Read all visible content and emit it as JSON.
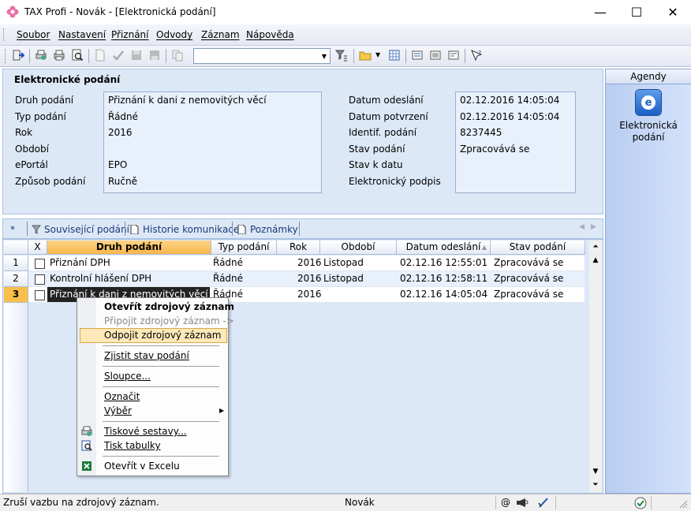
{
  "window": {
    "title": "TAX Profi - Novák - [Elektronická podání]",
    "minimize": "—",
    "maximize": "☐",
    "close": "✕"
  },
  "menu": [
    "Soubor",
    "Nastavení",
    "Přiznání",
    "Odvody",
    "Záznam",
    "Nápověda"
  ],
  "toolbar": {
    "combo_value": ""
  },
  "detail": {
    "title": "Elektronické podání",
    "left_labels": [
      "Druh podání",
      "Typ podání",
      "Rok",
      "Období",
      "ePortál",
      "Způsob podání"
    ],
    "left_values": [
      "Přiznání k dani z nemovitých věcí",
      "Řádné",
      "2016",
      "",
      "EPO",
      "Ručně"
    ],
    "right_labels": [
      "Datum odeslání",
      "Datum potvrzení",
      "Identif. podání",
      "Stav podání",
      "Stav k datu",
      "Elektronický podpis"
    ],
    "right_values": [
      "02.12.2016 14:05:04",
      "02.12.2016 14:05:04",
      "8237445",
      "Zpracovává se",
      "",
      ""
    ]
  },
  "agendy": {
    "title": "Agendy",
    "item_label": "Elektronická podání"
  },
  "tabs": {
    "star": "*",
    "items": [
      "Související podání",
      "Historie komunikace",
      "Poznámky"
    ]
  },
  "grid": {
    "columns": [
      "X",
      "Druh podání",
      "Typ podání",
      "Rok",
      "Období",
      "Datum odeslání",
      "Stav podání"
    ],
    "rows": [
      {
        "num": "1",
        "druh": "Přiznání DPH",
        "typ": "Řádné",
        "rok": "2016",
        "obdobi": "Listopad",
        "datum": "02.12.16 12:55:01",
        "stav": "Zpracovává se"
      },
      {
        "num": "2",
        "druh": "Kontrolní hlášení DPH",
        "typ": "Řádné",
        "rok": "2016",
        "obdobi": "Listopad",
        "datum": "02.12.16 12:58:11",
        "stav": "Zpracovává se"
      },
      {
        "num": "3",
        "druh": "Přiznání k dani z nemovitých věcí",
        "typ": "Řádné",
        "rok": "2016",
        "obdobi": "",
        "datum": "02.12.16 14:05:04",
        "stav": "Zpracovává se"
      }
    ]
  },
  "context_menu": {
    "items": [
      "Otevřít zdrojový záznam",
      "Připojit zdrojový záznam ->",
      "Odpojit zdrojový záznam",
      "Zjistit stav podání",
      "Sloupce...",
      "Označit",
      "Výběr",
      "Tiskové sestavy...",
      "Tisk tabulky",
      "Otevřít v Excelu"
    ]
  },
  "status": {
    "text": "Zruší vazbu na zdrojový záznam.",
    "user": "Novák"
  }
}
